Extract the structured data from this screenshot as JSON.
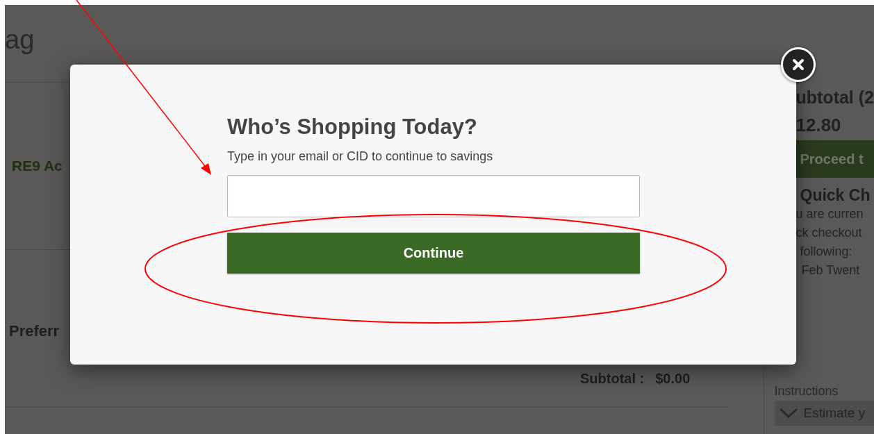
{
  "page": {
    "heading": "ag",
    "item_name": "RE9 Ac",
    "section_label": "Preferr",
    "subtotal_label": "Subtotal :",
    "subtotal_value": "$0.00"
  },
  "summary": {
    "title": "ubtotal (2",
    "amount": "12.80",
    "proceed_button": "Proceed t",
    "quick_title": "Quick Ch",
    "quick_lines": [
      "u are curren",
      "ck checkout",
      "following:",
      "Feb Twent"
    ],
    "instructions_label": "Instructions",
    "estimate_field": "Estimate y"
  },
  "modal": {
    "title": "Who’s Shopping Today?",
    "subtitle": "Type in your email or CID to continue to savings",
    "button": "Continue"
  }
}
